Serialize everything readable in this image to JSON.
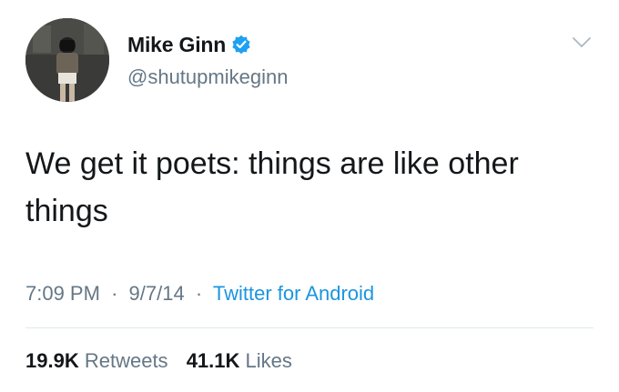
{
  "user": {
    "display_name": "Mike Ginn",
    "handle": "@shutupmikeginn",
    "verified": true
  },
  "tweet": {
    "text": "We get it poets: things are like other things",
    "time": "7:09 PM",
    "separator": "·",
    "date": "9/7/14",
    "source": "Twitter for Android"
  },
  "stats": {
    "retweets_count": "19.9K",
    "retweets_label": "Retweets",
    "likes_count": "41.1K",
    "likes_label": "Likes"
  },
  "icons": {
    "verified": "verified-badge-icon",
    "menu": "chevron-down-icon"
  },
  "colors": {
    "text": "#14171a",
    "muted": "#657786",
    "link": "#1b95e0",
    "verified": "#1da1f2",
    "divider": "#e1e8ed"
  }
}
